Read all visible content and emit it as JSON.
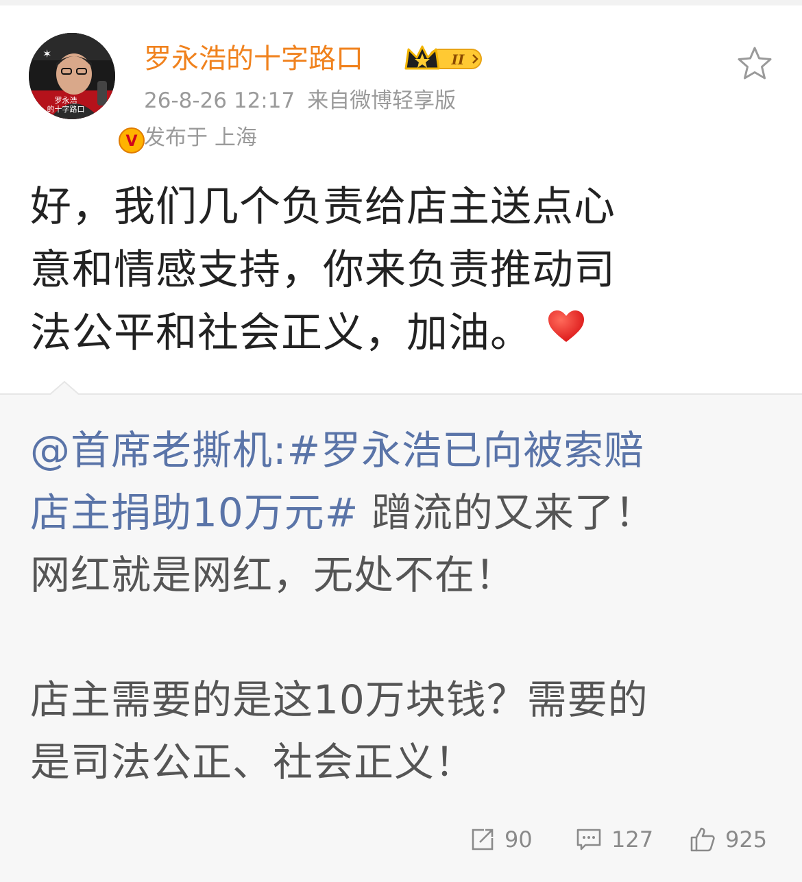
{
  "author": {
    "name": "罗永浩的十字路口",
    "avatar_caption_line1": "罗永浩",
    "avatar_caption_line2": "的十字路口",
    "badge_level": "II",
    "verified": "V"
  },
  "post": {
    "timestamp": "26-8-26 12:17",
    "source": "来自微博轻享版",
    "location": "发布于 上海",
    "lines": [
      "好，我们几个负责给店主送点心",
      "意和情感支持，你来负责推动司",
      "法公平和社会正义，加油。"
    ]
  },
  "retweet": {
    "mention": "@首席老撕机",
    "colon": ":",
    "hashtag_part1": "#罗永浩已向被索赔",
    "hashtag_part2": "店主捐助10万元#",
    "line2_tail": " 蹭流的又来了！",
    "line3": "网红就是网红，无处不在！",
    "line4": "店主需要的是这10万块钱？需要的",
    "line5": "是司法公正、社会正义！"
  },
  "stats": {
    "reposts": "90",
    "comments": "127",
    "likes": "925"
  },
  "icons": {
    "favorite": "star-outline-icon",
    "heart": "heart-emoji-icon",
    "repost": "repost-icon",
    "comment": "comment-icon",
    "like": "thumbs-up-icon"
  },
  "colors": {
    "username": "#f0821e",
    "link": "#5a74a8",
    "meta": "#9a9a9a",
    "retweet_bg": "#f7f7f7"
  }
}
